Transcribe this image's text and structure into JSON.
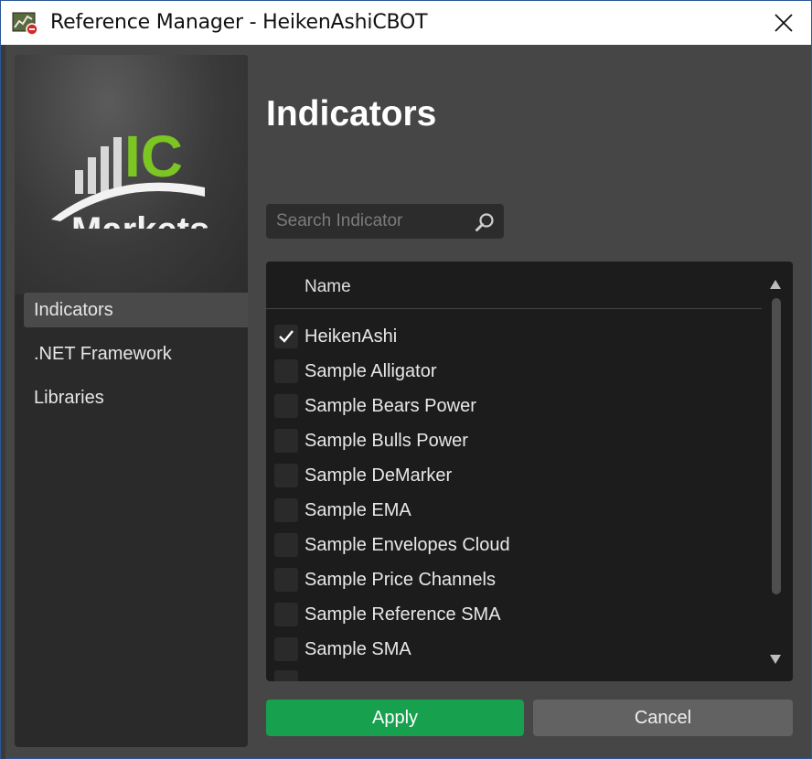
{
  "window": {
    "title": "Reference Manager - HeikenAshiCBOT"
  },
  "logo": {
    "brand_top": "IC",
    "brand_bottom": "Markets",
    "green": "#7cc623"
  },
  "sidebar": {
    "items": [
      {
        "label": "Indicators",
        "active": true
      },
      {
        "label": ".NET Framework",
        "active": false
      },
      {
        "label": "Libraries",
        "active": false
      }
    ]
  },
  "main": {
    "title": "Indicators",
    "search": {
      "placeholder": "Search Indicator",
      "value": ""
    },
    "list": {
      "column_header": "Name",
      "rows": [
        {
          "label": "HeikenAshi",
          "checked": true
        },
        {
          "label": "Sample Alligator",
          "checked": false
        },
        {
          "label": "Sample Bears Power",
          "checked": false
        },
        {
          "label": "Sample Bulls Power",
          "checked": false
        },
        {
          "label": "Sample DeMarker",
          "checked": false
        },
        {
          "label": "Sample EMA",
          "checked": false
        },
        {
          "label": "Sample Envelopes Cloud",
          "checked": false
        },
        {
          "label": "Sample Price Channels",
          "checked": false
        },
        {
          "label": "Sample Reference SMA",
          "checked": false
        },
        {
          "label": "Sample SMA",
          "checked": false
        }
      ]
    }
  },
  "buttons": {
    "apply": "Apply",
    "cancel": "Cancel"
  },
  "colors": {
    "accent": "#17a04d",
    "panel": "#1c1c1c",
    "window": "#464646"
  }
}
